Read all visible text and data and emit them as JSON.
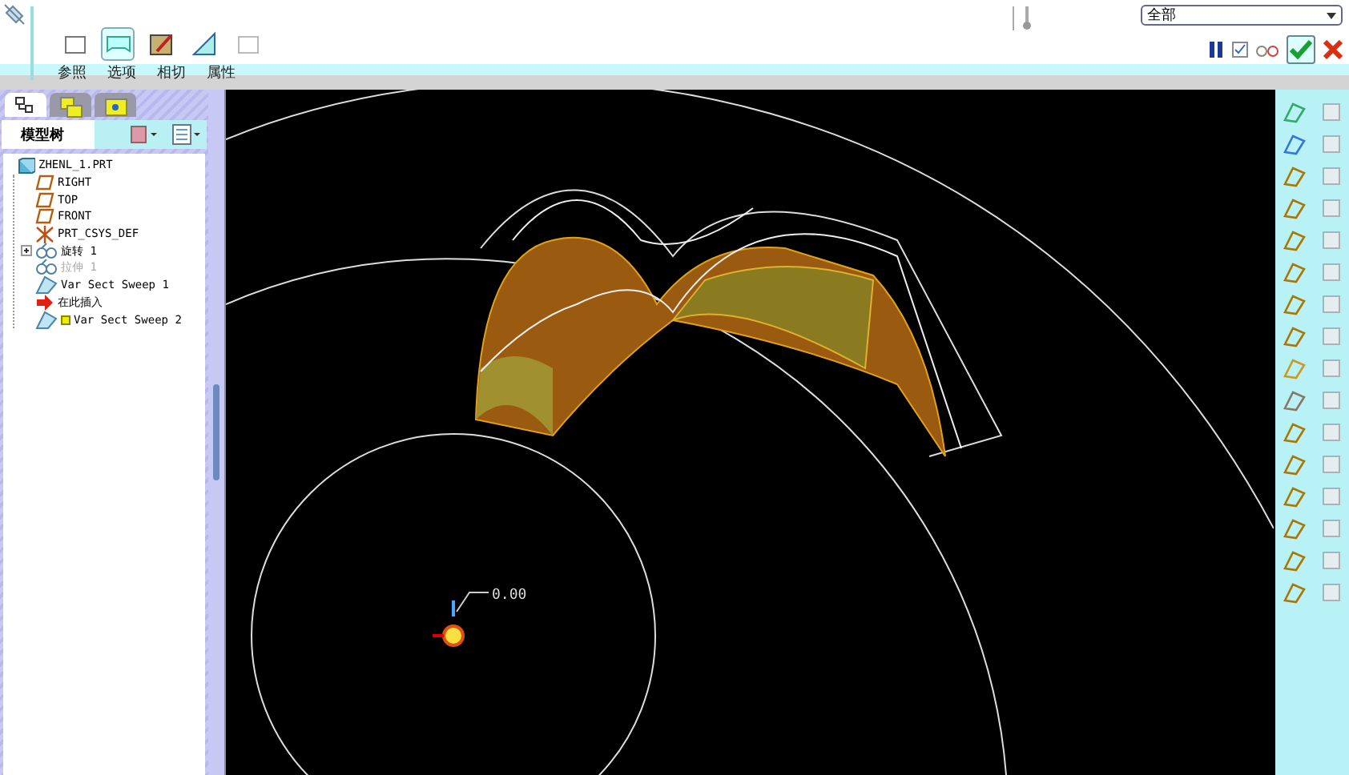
{
  "dashboard": {
    "tool_buttons": [
      {
        "selected": false
      },
      {
        "selected": true
      },
      {
        "selected": false
      },
      {
        "selected": false
      },
      {
        "selected": false
      }
    ],
    "tabs": [
      {
        "label": "参照"
      },
      {
        "label": "选项"
      },
      {
        "label": "相切"
      },
      {
        "label": "属性"
      }
    ],
    "filter": {
      "value": "全部"
    }
  },
  "navigator": {
    "tabs": [
      {
        "selected": true
      },
      {
        "selected": false
      },
      {
        "selected": false
      }
    ],
    "title": "模型树",
    "tree": [
      {
        "label": "ZHENL_1.PRT",
        "kind": "part",
        "disabled": false,
        "children": [
          {
            "label": "RIGHT",
            "kind": "plane",
            "disabled": false
          },
          {
            "label": "TOP",
            "kind": "plane",
            "disabled": false
          },
          {
            "label": "FRONT",
            "kind": "plane",
            "disabled": false
          },
          {
            "label": "PRT_CSYS_DEF",
            "kind": "csys",
            "disabled": false
          },
          {
            "label": "旋转 1",
            "kind": "revolve",
            "disabled": false,
            "expandable": true
          },
          {
            "label": "拉伸 1",
            "kind": "revolve",
            "disabled": true
          },
          {
            "label": "Var Sect Sweep 1",
            "kind": "sweep",
            "disabled": false
          },
          {
            "label": "在此插入",
            "kind": "insert",
            "disabled": false
          },
          {
            "label": "Var Sect Sweep 2",
            "kind": "sweep",
            "disabled": false,
            "active": true
          }
        ]
      }
    ]
  },
  "viewport": {
    "dimension": "0.00"
  }
}
